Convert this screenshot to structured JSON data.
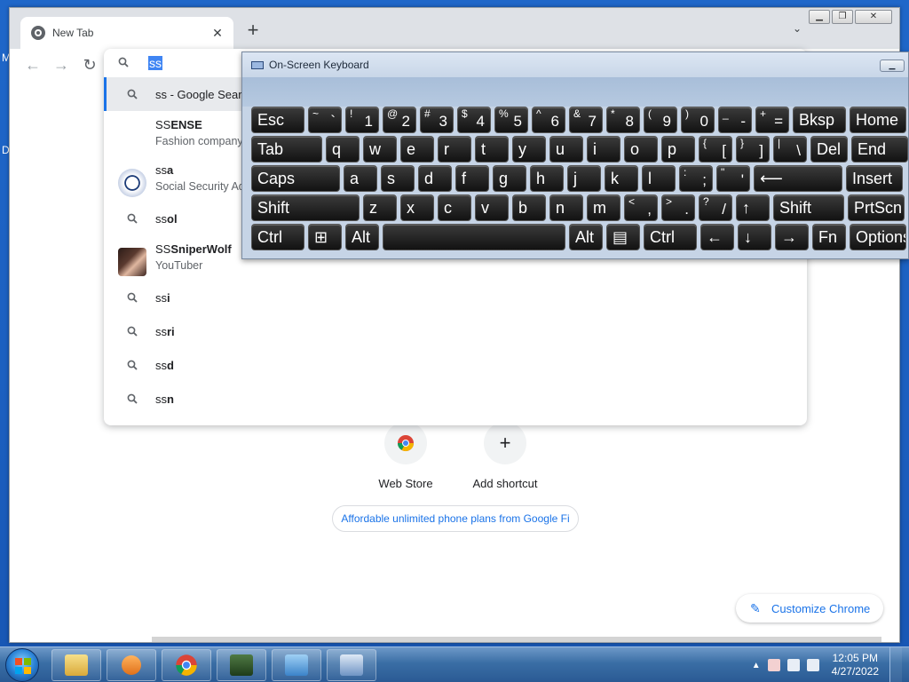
{
  "desktop": {
    "edge_letters": [
      "M",
      "D"
    ]
  },
  "browser": {
    "tab_title": "New Tab",
    "tab_close": "✕",
    "new_tab": "+",
    "tab_search": "⌄",
    "window_controls": {
      "minimize": "▁",
      "maximize": "❐",
      "close": "✕"
    },
    "nav": {
      "back": "←",
      "forward": "→",
      "reload": "↻"
    }
  },
  "omnibox": {
    "typed": "ss",
    "suggestions": [
      {
        "icon": "search-icon",
        "bold": "",
        "text": "ss - Google Search",
        "sub": ""
      },
      {
        "icon": "blank",
        "prefix": "SS",
        "bold": "ENSE",
        "sub": "Fashion company"
      },
      {
        "icon": "seal-image",
        "prefix": "ss",
        "bold": "a",
        "sub": "Social Security Administration"
      },
      {
        "icon": "search-icon",
        "prefix": "ss",
        "bold": "ol",
        "sub": ""
      },
      {
        "icon": "person-image",
        "prefix": "SS",
        "bold": "SniperWolf",
        "sub": "YouTuber"
      },
      {
        "icon": "search-icon",
        "prefix": "ss",
        "bold": "i",
        "sub": ""
      },
      {
        "icon": "search-icon",
        "prefix": "ss",
        "bold": "ri",
        "sub": ""
      },
      {
        "icon": "search-icon",
        "prefix": "ss",
        "bold": "d",
        "sub": ""
      },
      {
        "icon": "search-icon",
        "prefix": "ss",
        "bold": "n",
        "sub": ""
      }
    ]
  },
  "ntp": {
    "shortcuts": [
      {
        "label": "Web Store",
        "icon": "chrome-webstore-icon"
      },
      {
        "label": "Add shortcut",
        "icon": "plus-icon",
        "glyph": "+"
      }
    ],
    "promo": "Affordable unlimited phone plans from Google Fi",
    "customize": "Customize Chrome"
  },
  "osk": {
    "title": "On-Screen Keyboard",
    "rows": [
      [
        {
          "l": "Esc"
        },
        {
          "s": "~",
          "b": "`"
        },
        {
          "s": "!",
          "b": "1"
        },
        {
          "s": "@",
          "b": "2"
        },
        {
          "s": "#",
          "b": "3"
        },
        {
          "s": "$",
          "b": "4"
        },
        {
          "s": "%",
          "b": "5"
        },
        {
          "s": "^",
          "b": "6"
        },
        {
          "s": "&",
          "b": "7"
        },
        {
          "s": "*",
          "b": "8"
        },
        {
          "s": "(",
          "b": "9"
        },
        {
          "s": ")",
          "b": "0"
        },
        {
          "s": "_",
          "b": "-"
        },
        {
          "s": "+",
          "b": "="
        },
        {
          "l": "Bksp"
        },
        {
          "l": "Home"
        }
      ],
      [
        {
          "l": "Tab"
        },
        {
          "l": "q"
        },
        {
          "l": "w"
        },
        {
          "l": "e"
        },
        {
          "l": "r"
        },
        {
          "l": "t"
        },
        {
          "l": "y"
        },
        {
          "l": "u"
        },
        {
          "l": "i"
        },
        {
          "l": "o"
        },
        {
          "l": "p"
        },
        {
          "s": "{",
          "b": "["
        },
        {
          "s": "}",
          "b": "]"
        },
        {
          "s": "|",
          "b": "\\"
        },
        {
          "l": "Del"
        },
        {
          "l": "End"
        }
      ],
      [
        {
          "l": "Caps"
        },
        {
          "l": "a"
        },
        {
          "l": "s"
        },
        {
          "l": "d"
        },
        {
          "l": "f"
        },
        {
          "l": "g"
        },
        {
          "l": "h"
        },
        {
          "l": "j"
        },
        {
          "l": "k"
        },
        {
          "l": "l"
        },
        {
          "s": ":",
          "b": ";"
        },
        {
          "s": "\"",
          "b": "'"
        },
        {
          "l": "⟵"
        },
        {
          "l": "Insert"
        }
      ],
      [
        {
          "l": "Shift"
        },
        {
          "l": "z"
        },
        {
          "l": "x"
        },
        {
          "l": "c"
        },
        {
          "l": "v"
        },
        {
          "l": "b"
        },
        {
          "l": "n"
        },
        {
          "l": "m"
        },
        {
          "s": "<",
          "b": ","
        },
        {
          "s": ">",
          "b": "."
        },
        {
          "s": "?",
          "b": "/"
        },
        {
          "l": "↑"
        },
        {
          "l": "Shift"
        },
        {
          "l": "PrtScn"
        }
      ],
      [
        {
          "l": "Ctrl"
        },
        {
          "l": "⊞"
        },
        {
          "l": "Alt"
        },
        {
          "l": ""
        },
        {
          "l": "Alt"
        },
        {
          "l": "▤"
        },
        {
          "l": "Ctrl"
        },
        {
          "l": "←"
        },
        {
          "l": "↓"
        },
        {
          "l": "→"
        },
        {
          "l": "Fn"
        },
        {
          "l": "Options"
        }
      ]
    ]
  },
  "taskbar": {
    "time": "12:05 PM",
    "date": "4/27/2022",
    "tray_arrow": "▲",
    "apps": [
      "file-explorer-icon",
      "media-player-icon",
      "chrome-icon",
      "task-manager-icon",
      "control-panel-icon",
      "remote-desktop-icon"
    ],
    "colors": {
      "explorer": "#e8c25a",
      "media": "#f08a24",
      "chrome_red": "#db4437",
      "chrome_green": "#0f9d58",
      "chrome_yellow": "#f4b400",
      "chrome_blue": "#4285f4"
    }
  }
}
